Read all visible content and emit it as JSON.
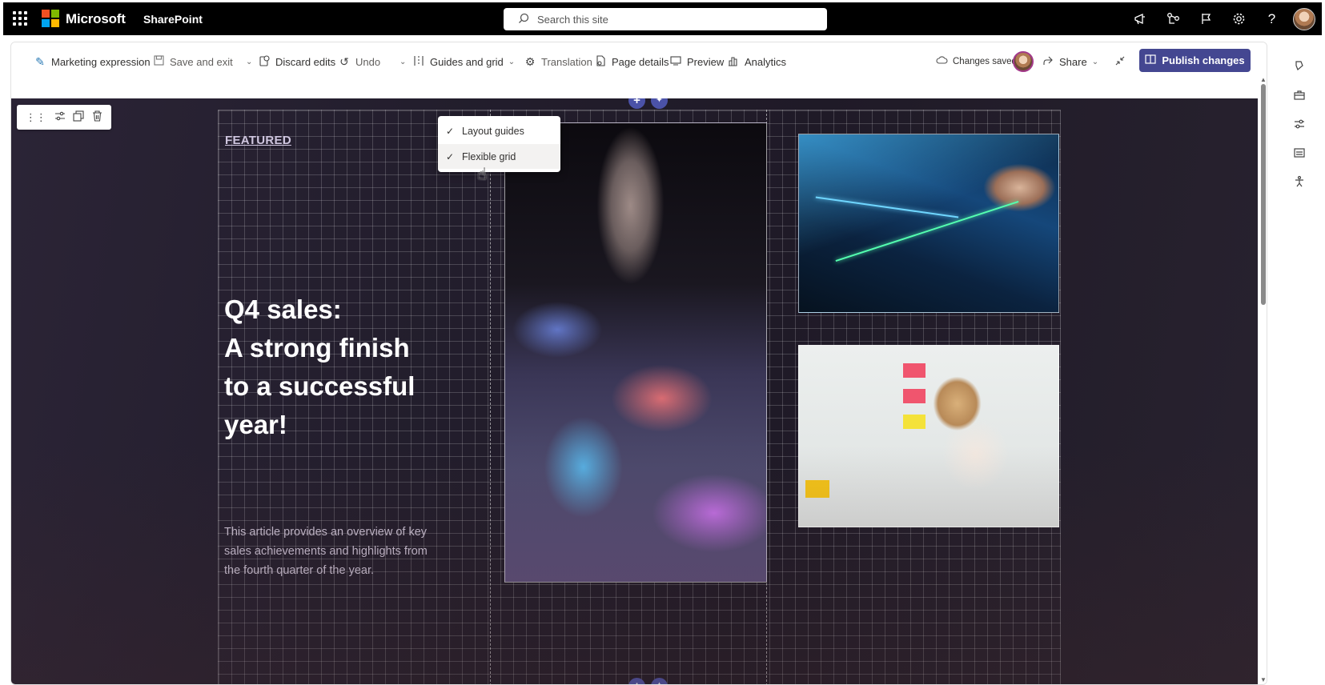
{
  "suite": {
    "brand": "Microsoft",
    "app": "SharePoint",
    "search_placeholder": "Search this site",
    "logo_colors": [
      "#f25022",
      "#7fba00",
      "#00a4ef",
      "#ffb900"
    ],
    "icons": [
      "megaphone-icon",
      "share-network-icon",
      "flag-icon",
      "settings-icon",
      "help-icon"
    ]
  },
  "commands": {
    "page_title": "Marketing expression",
    "save_exit": "Save and exit",
    "discard": "Discard edits",
    "undo": "Undo",
    "guides": "Guides and grid",
    "translation": "Translation",
    "page_details": "Page details",
    "preview": "Preview",
    "analytics": "Analytics",
    "status": "Changes saved",
    "share": "Share",
    "publish": "Publish changes"
  },
  "dropdown": {
    "items": [
      {
        "label": "Layout guides",
        "checked": true
      },
      {
        "label": "Flexible grid",
        "checked": true
      }
    ]
  },
  "hero": {
    "tag": "FEATURED",
    "headline": [
      "Q4 sales:",
      "A strong finish",
      "to a successful",
      "year!"
    ],
    "description": "This article provides an overview of key sales achievements and highlights from the fourth quarter of the year."
  },
  "colors": {
    "publish_bg": "#444791",
    "add_button": "#4b52a8",
    "hero_bg": "#231e2d"
  }
}
